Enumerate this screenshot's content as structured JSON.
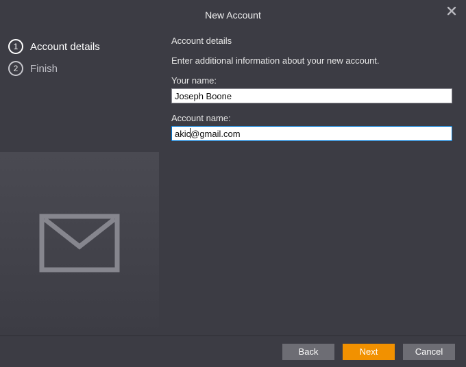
{
  "title": "New Account",
  "sidebar": {
    "steps": [
      {
        "num": "1",
        "label": "Account details",
        "active": true
      },
      {
        "num": "2",
        "label": "Finish",
        "active": false
      }
    ]
  },
  "content": {
    "heading": "Account details",
    "instruction": "Enter additional information about your new account.",
    "your_name_label": "Your name:",
    "your_name_value": "Joseph Boone",
    "account_name_label": "Account name:",
    "account_name_value": "akic@gmail.com"
  },
  "buttons": {
    "back": "Back",
    "next": "Next",
    "cancel": "Cancel"
  },
  "icons": {
    "close": "close-icon",
    "mail": "mail-icon"
  },
  "colors": {
    "accent": "#f29100",
    "panel": "#3c3c44",
    "button_secondary": "#6d6d74"
  }
}
